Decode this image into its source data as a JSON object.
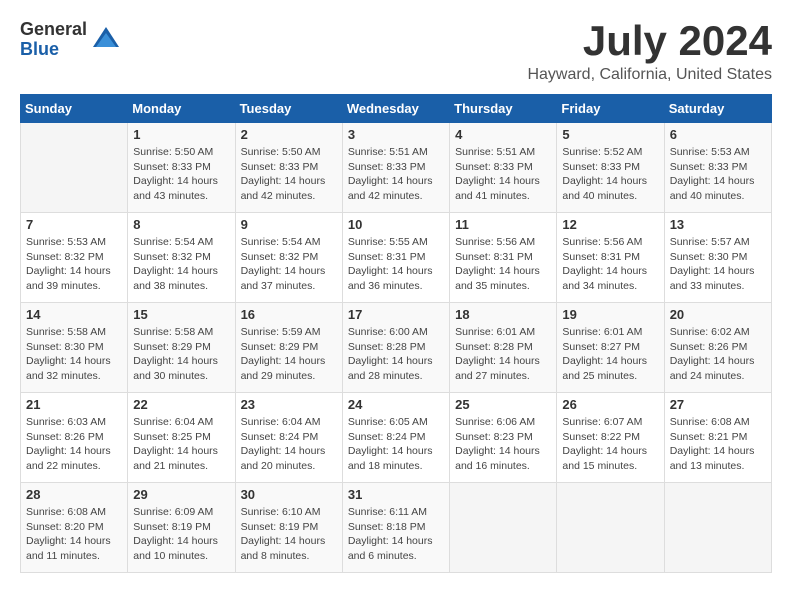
{
  "logo": {
    "general": "General",
    "blue": "Blue"
  },
  "title": "July 2024",
  "location": "Hayward, California, United States",
  "days_header": [
    "Sunday",
    "Monday",
    "Tuesday",
    "Wednesday",
    "Thursday",
    "Friday",
    "Saturday"
  ],
  "weeks": [
    [
      {
        "num": "",
        "info": ""
      },
      {
        "num": "1",
        "info": "Sunrise: 5:50 AM\nSunset: 8:33 PM\nDaylight: 14 hours\nand 43 minutes."
      },
      {
        "num": "2",
        "info": "Sunrise: 5:50 AM\nSunset: 8:33 PM\nDaylight: 14 hours\nand 42 minutes."
      },
      {
        "num": "3",
        "info": "Sunrise: 5:51 AM\nSunset: 8:33 PM\nDaylight: 14 hours\nand 42 minutes."
      },
      {
        "num": "4",
        "info": "Sunrise: 5:51 AM\nSunset: 8:33 PM\nDaylight: 14 hours\nand 41 minutes."
      },
      {
        "num": "5",
        "info": "Sunrise: 5:52 AM\nSunset: 8:33 PM\nDaylight: 14 hours\nand 40 minutes."
      },
      {
        "num": "6",
        "info": "Sunrise: 5:53 AM\nSunset: 8:33 PM\nDaylight: 14 hours\nand 40 minutes."
      }
    ],
    [
      {
        "num": "7",
        "info": "Sunrise: 5:53 AM\nSunset: 8:32 PM\nDaylight: 14 hours\nand 39 minutes."
      },
      {
        "num": "8",
        "info": "Sunrise: 5:54 AM\nSunset: 8:32 PM\nDaylight: 14 hours\nand 38 minutes."
      },
      {
        "num": "9",
        "info": "Sunrise: 5:54 AM\nSunset: 8:32 PM\nDaylight: 14 hours\nand 37 minutes."
      },
      {
        "num": "10",
        "info": "Sunrise: 5:55 AM\nSunset: 8:31 PM\nDaylight: 14 hours\nand 36 minutes."
      },
      {
        "num": "11",
        "info": "Sunrise: 5:56 AM\nSunset: 8:31 PM\nDaylight: 14 hours\nand 35 minutes."
      },
      {
        "num": "12",
        "info": "Sunrise: 5:56 AM\nSunset: 8:31 PM\nDaylight: 14 hours\nand 34 minutes."
      },
      {
        "num": "13",
        "info": "Sunrise: 5:57 AM\nSunset: 8:30 PM\nDaylight: 14 hours\nand 33 minutes."
      }
    ],
    [
      {
        "num": "14",
        "info": "Sunrise: 5:58 AM\nSunset: 8:30 PM\nDaylight: 14 hours\nand 32 minutes."
      },
      {
        "num": "15",
        "info": "Sunrise: 5:58 AM\nSunset: 8:29 PM\nDaylight: 14 hours\nand 30 minutes."
      },
      {
        "num": "16",
        "info": "Sunrise: 5:59 AM\nSunset: 8:29 PM\nDaylight: 14 hours\nand 29 minutes."
      },
      {
        "num": "17",
        "info": "Sunrise: 6:00 AM\nSunset: 8:28 PM\nDaylight: 14 hours\nand 28 minutes."
      },
      {
        "num": "18",
        "info": "Sunrise: 6:01 AM\nSunset: 8:28 PM\nDaylight: 14 hours\nand 27 minutes."
      },
      {
        "num": "19",
        "info": "Sunrise: 6:01 AM\nSunset: 8:27 PM\nDaylight: 14 hours\nand 25 minutes."
      },
      {
        "num": "20",
        "info": "Sunrise: 6:02 AM\nSunset: 8:26 PM\nDaylight: 14 hours\nand 24 minutes."
      }
    ],
    [
      {
        "num": "21",
        "info": "Sunrise: 6:03 AM\nSunset: 8:26 PM\nDaylight: 14 hours\nand 22 minutes."
      },
      {
        "num": "22",
        "info": "Sunrise: 6:04 AM\nSunset: 8:25 PM\nDaylight: 14 hours\nand 21 minutes."
      },
      {
        "num": "23",
        "info": "Sunrise: 6:04 AM\nSunset: 8:24 PM\nDaylight: 14 hours\nand 20 minutes."
      },
      {
        "num": "24",
        "info": "Sunrise: 6:05 AM\nSunset: 8:24 PM\nDaylight: 14 hours\nand 18 minutes."
      },
      {
        "num": "25",
        "info": "Sunrise: 6:06 AM\nSunset: 8:23 PM\nDaylight: 14 hours\nand 16 minutes."
      },
      {
        "num": "26",
        "info": "Sunrise: 6:07 AM\nSunset: 8:22 PM\nDaylight: 14 hours\nand 15 minutes."
      },
      {
        "num": "27",
        "info": "Sunrise: 6:08 AM\nSunset: 8:21 PM\nDaylight: 14 hours\nand 13 minutes."
      }
    ],
    [
      {
        "num": "28",
        "info": "Sunrise: 6:08 AM\nSunset: 8:20 PM\nDaylight: 14 hours\nand 11 minutes."
      },
      {
        "num": "29",
        "info": "Sunrise: 6:09 AM\nSunset: 8:19 PM\nDaylight: 14 hours\nand 10 minutes."
      },
      {
        "num": "30",
        "info": "Sunrise: 6:10 AM\nSunset: 8:19 PM\nDaylight: 14 hours\nand 8 minutes."
      },
      {
        "num": "31",
        "info": "Sunrise: 6:11 AM\nSunset: 8:18 PM\nDaylight: 14 hours\nand 6 minutes."
      },
      {
        "num": "",
        "info": ""
      },
      {
        "num": "",
        "info": ""
      },
      {
        "num": "",
        "info": ""
      }
    ]
  ]
}
